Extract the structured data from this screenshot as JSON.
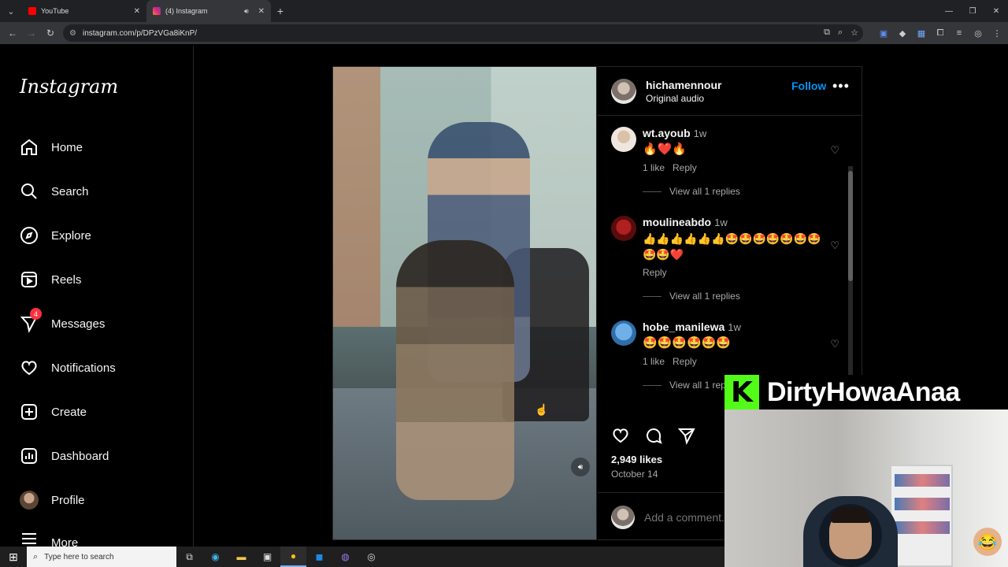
{
  "browser": {
    "tabs": [
      {
        "title": "YouTube",
        "color": "#ff0000"
      },
      {
        "title": "(4) Instagram",
        "color": "#e1306c"
      }
    ],
    "url": "instagram.com/p/DPzVGa8iKnP/"
  },
  "sidebar": {
    "logo": "Instagram",
    "items": [
      {
        "label": "Home",
        "icon": "home-icon"
      },
      {
        "label": "Search",
        "icon": "search-icon"
      },
      {
        "label": "Explore",
        "icon": "explore-icon"
      },
      {
        "label": "Reels",
        "icon": "reels-icon"
      },
      {
        "label": "Messages",
        "icon": "messages-icon",
        "badge": "4"
      },
      {
        "label": "Notifications",
        "icon": "heart-icon"
      },
      {
        "label": "Create",
        "icon": "plus-icon"
      },
      {
        "label": "Dashboard",
        "icon": "dashboard-icon"
      },
      {
        "label": "Profile",
        "icon": "avatar"
      },
      {
        "label": "More",
        "icon": "menu-icon"
      }
    ]
  },
  "post": {
    "author": "hichamennour",
    "audio": "Original audio",
    "follow_label": "Follow",
    "likes": "2,949 likes",
    "date": "October 14",
    "add_comment_placeholder": "Add a comment..."
  },
  "comments": [
    {
      "user": "wt.ayoub",
      "time": "1w",
      "text": "🔥❤️🔥",
      "likes": "1 like",
      "reply": "Reply",
      "replies": "View all 1 replies"
    },
    {
      "user": "moulineabdo",
      "time": "1w",
      "text": "👍👍👍👍👍👍🤩🤩🤩🤩🤩🤩🤩🤩🤩❤️",
      "likes": "",
      "reply": "Reply",
      "replies": "View all 1 replies"
    },
    {
      "user": "hobe_manilewa",
      "time": "1w",
      "text": "🤩🤩🤩🤩🤩🤩",
      "likes": "1 like",
      "reply": "Reply",
      "replies": "View all 1 rep"
    }
  ],
  "overlay": {
    "channel": "DirtyHowaAnaa",
    "kick_letter": "K",
    "accent": "#53fc18"
  },
  "taskbar": {
    "search_placeholder": "Type here to search"
  }
}
